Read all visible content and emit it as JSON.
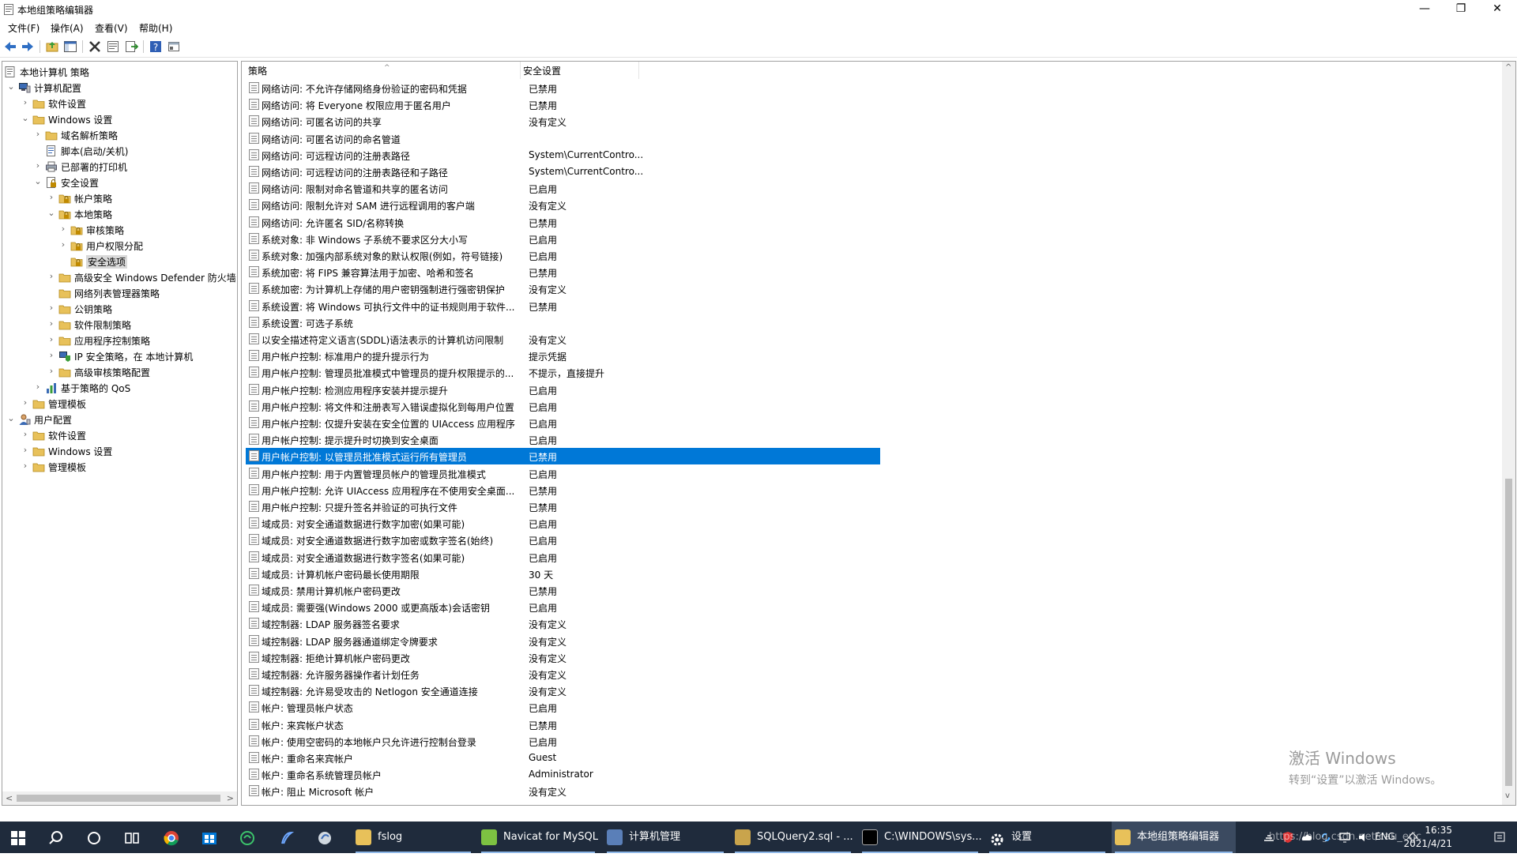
{
  "window": {
    "title": "本地组策略编辑器",
    "minimize_glyph": "—",
    "maximize_glyph": "❐",
    "close_glyph": "✕"
  },
  "menu": [
    "文件(F)",
    "操作(A)",
    "查看(V)",
    "帮助(H)"
  ],
  "tree": [
    {
      "label": "本地计算机 策略",
      "level": 0,
      "expander": "",
      "icon": "computer-policy-icon"
    },
    {
      "label": "计算机配置",
      "level": 0,
      "expander": "⌄",
      "icon": "computer-icon"
    },
    {
      "label": "软件设置",
      "level": 1,
      "expander": "›",
      "icon": "folder-icon"
    },
    {
      "label": "Windows 设置",
      "level": 1,
      "expander": "⌄",
      "icon": "folder-icon"
    },
    {
      "label": "域名解析策略",
      "level": 2,
      "expander": "›",
      "icon": "folder-icon"
    },
    {
      "label": "脚本(启动/关机)",
      "level": 2,
      "expander": "",
      "icon": "script-icon"
    },
    {
      "label": "已部署的打印机",
      "level": 2,
      "expander": "›",
      "icon": "printer-icon"
    },
    {
      "label": "安全设置",
      "level": 2,
      "expander": "⌄",
      "icon": "security-settings-icon"
    },
    {
      "label": "帐户策略",
      "level": 3,
      "expander": "›",
      "icon": "lock-folder-icon"
    },
    {
      "label": "本地策略",
      "level": 3,
      "expander": "⌄",
      "icon": "lock-folder-icon"
    },
    {
      "label": "审核策略",
      "level": 4,
      "expander": "›",
      "icon": "lock-folder-icon"
    },
    {
      "label": "用户权限分配",
      "level": 4,
      "expander": "›",
      "icon": "lock-folder-icon"
    },
    {
      "label": "安全选项",
      "level": 4,
      "expander": "",
      "icon": "lock-folder-icon",
      "selected": true
    },
    {
      "label": "高级安全 Windows Defender 防火墙",
      "level": 3,
      "expander": "›",
      "icon": "folder-icon"
    },
    {
      "label": "网络列表管理器策略",
      "level": 3,
      "expander": "",
      "icon": "folder-icon"
    },
    {
      "label": "公钥策略",
      "level": 3,
      "expander": "›",
      "icon": "folder-icon"
    },
    {
      "label": "软件限制策略",
      "level": 3,
      "expander": "›",
      "icon": "folder-icon"
    },
    {
      "label": "应用程序控制策略",
      "level": 3,
      "expander": "›",
      "icon": "folder-icon"
    },
    {
      "label": "IP 安全策略，在 本地计算机",
      "level": 3,
      "expander": "›",
      "icon": "ip-security-icon"
    },
    {
      "label": "高级审核策略配置",
      "level": 3,
      "expander": "›",
      "icon": "folder-icon"
    },
    {
      "label": "基于策略的 QoS",
      "level": 2,
      "expander": "›",
      "icon": "qos-chart-icon"
    },
    {
      "label": "管理模板",
      "level": 1,
      "expander": "›",
      "icon": "folder-icon"
    },
    {
      "label": "用户配置",
      "level": 0,
      "expander": "⌄",
      "icon": "user-icon"
    },
    {
      "label": "软件设置",
      "level": 1,
      "expander": "›",
      "icon": "folder-icon"
    },
    {
      "label": "Windows 设置",
      "level": 1,
      "expander": "›",
      "icon": "folder-icon"
    },
    {
      "label": "管理模板",
      "level": 1,
      "expander": "›",
      "icon": "folder-icon"
    }
  ],
  "list": {
    "columns": [
      "策略",
      "安全设置"
    ],
    "sort_glyph": "^",
    "rows": [
      {
        "policy": "网络访问: 不允许存储网络身份验证的密码和凭据",
        "setting": "已禁用"
      },
      {
        "policy": "网络访问: 将 Everyone 权限应用于匿名用户",
        "setting": "已禁用"
      },
      {
        "policy": "网络访问: 可匿名访问的共享",
        "setting": "没有定义"
      },
      {
        "policy": "网络访问: 可匿名访问的命名管道",
        "setting": ""
      },
      {
        "policy": "网络访问: 可远程访问的注册表路径",
        "setting": "System\\CurrentContro..."
      },
      {
        "policy": "网络访问: 可远程访问的注册表路径和子路径",
        "setting": "System\\CurrentContro..."
      },
      {
        "policy": "网络访问: 限制对命名管道和共享的匿名访问",
        "setting": "已启用"
      },
      {
        "policy": "网络访问: 限制允许对 SAM 进行远程调用的客户端",
        "setting": "没有定义"
      },
      {
        "policy": "网络访问: 允许匿名 SID/名称转换",
        "setting": "已禁用"
      },
      {
        "policy": "系统对象: 非 Windows 子系统不要求区分大小写",
        "setting": "已启用"
      },
      {
        "policy": "系统对象: 加强内部系统对象的默认权限(例如，符号链接)",
        "setting": "已启用"
      },
      {
        "policy": "系统加密: 将 FIPS 兼容算法用于加密、哈希和签名",
        "setting": "已禁用"
      },
      {
        "policy": "系统加密: 为计算机上存储的用户密钥强制进行强密钥保护",
        "setting": "没有定义"
      },
      {
        "policy": "系统设置: 将 Windows 可执行文件中的证书规则用于软件...",
        "setting": "已禁用"
      },
      {
        "policy": "系统设置: 可选子系统",
        "setting": ""
      },
      {
        "policy": "以安全描述符定义语言(SDDL)语法表示的计算机访问限制",
        "setting": "没有定义"
      },
      {
        "policy": "用户帐户控制: 标准用户的提升提示行为",
        "setting": "提示凭据"
      },
      {
        "policy": "用户帐户控制: 管理员批准模式中管理员的提升权限提示的...",
        "setting": "不提示，直接提升"
      },
      {
        "policy": "用户帐户控制: 检测应用程序安装并提示提升",
        "setting": "已启用"
      },
      {
        "policy": "用户帐户控制: 将文件和注册表写入错误虚拟化到每用户位置",
        "setting": "已启用"
      },
      {
        "policy": "用户帐户控制: 仅提升安装在安全位置的 UIAccess 应用程序",
        "setting": "已启用"
      },
      {
        "policy": "用户帐户控制: 提示提升时切换到安全桌面",
        "setting": "已启用"
      },
      {
        "policy": "用户帐户控制: 以管理员批准模式运行所有管理员",
        "setting": "已禁用",
        "selected": true
      },
      {
        "policy": "用户帐户控制: 用于内置管理员帐户的管理员批准模式",
        "setting": "已启用"
      },
      {
        "policy": "用户帐户控制: 允许 UIAccess 应用程序在不使用安全桌面...",
        "setting": "已禁用"
      },
      {
        "policy": "用户帐户控制: 只提升签名并验证的可执行文件",
        "setting": "已禁用"
      },
      {
        "policy": "域成员: 对安全通道数据进行数字加密(如果可能)",
        "setting": "已启用"
      },
      {
        "policy": "域成员: 对安全通道数据进行数字加密或数字签名(始终)",
        "setting": "已启用"
      },
      {
        "policy": "域成员: 对安全通道数据进行数字签名(如果可能)",
        "setting": "已启用"
      },
      {
        "policy": "域成员: 计算机帐户密码最长使用期限",
        "setting": "30 天"
      },
      {
        "policy": "域成员: 禁用计算机帐户密码更改",
        "setting": "已禁用"
      },
      {
        "policy": "域成员: 需要强(Windows 2000 或更高版本)会话密钥",
        "setting": "已启用"
      },
      {
        "policy": "域控制器: LDAP 服务器签名要求",
        "setting": "没有定义"
      },
      {
        "policy": "域控制器: LDAP 服务器通道绑定令牌要求",
        "setting": "没有定义"
      },
      {
        "policy": "域控制器: 拒绝计算机帐户密码更改",
        "setting": "没有定义"
      },
      {
        "policy": "域控制器: 允许服务器操作者计划任务",
        "setting": "没有定义"
      },
      {
        "policy": "域控制器:  允许易受攻击的 Netlogon 安全通道连接",
        "setting": "没有定义"
      },
      {
        "policy": "帐户: 管理员帐户状态",
        "setting": "已启用"
      },
      {
        "policy": "帐户: 来宾帐户状态",
        "setting": "已禁用"
      },
      {
        "policy": "帐户: 使用空密码的本地帐户只允许进行控制台登录",
        "setting": "已启用"
      },
      {
        "policy": "帐户: 重命名来宾帐户",
        "setting": "Guest"
      },
      {
        "policy": "帐户: 重命名系统管理员帐户",
        "setting": "Administrator"
      },
      {
        "policy": "帐户: 阻止 Microsoft 帐户",
        "setting": "没有定义"
      }
    ]
  },
  "scroll": {
    "up_glyph": "^",
    "down_glyph": "v",
    "left_glyph": "<",
    "right_glyph": ">"
  },
  "activation": {
    "line1": "激活 Windows",
    "line2": "转到“设置”以激活 Windows。"
  },
  "taskbar": {
    "tasks": [
      {
        "label": "fslog",
        "icon": "folder-icon",
        "color": "#e8c15a"
      },
      {
        "label": "Navicat for MySQL",
        "icon": "navicat-icon",
        "color": "#7dc242"
      },
      {
        "label": "计算机管理",
        "icon": "computer-management-icon",
        "color": "#5a7fb8"
      },
      {
        "label": "SQLQuery2.sql - ...",
        "icon": "ssms-icon",
        "color": "#c9a44c"
      },
      {
        "label": "C:\\WINDOWS\\sys...",
        "icon": "cmd-icon",
        "color": "#000000"
      },
      {
        "label": "设置",
        "icon": "settings-gear-icon",
        "color": "#1f2b3c"
      },
      {
        "label": "本地组策略编辑器",
        "icon": "gpedit-icon",
        "color": "#e8c15a"
      }
    ],
    "lang": "ENG",
    "time": "16:35",
    "date": "2021/4/21",
    "url_watermark": "https://blog.csdn.net/cau_eric"
  }
}
